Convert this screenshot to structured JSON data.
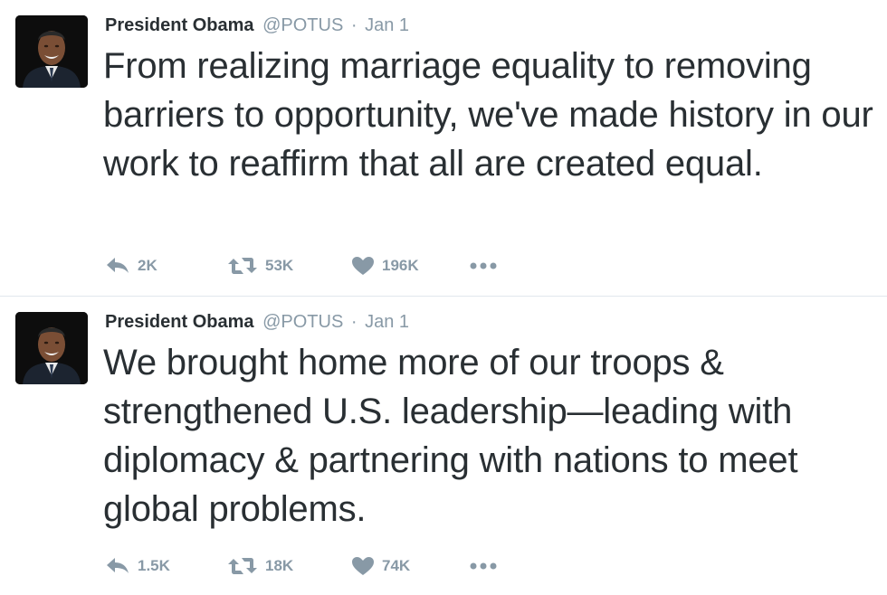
{
  "tweets": [
    {
      "name": "President Obama",
      "handle": "@POTUS",
      "separator": "·",
      "date": "Jan 1",
      "text": "From realizing marriage equality to removing barriers to opportunity, we've made history in our work to reaffirm that all are created equal.",
      "replies": "2K",
      "retweets": "53K",
      "likes": "196K"
    },
    {
      "name": "President Obama",
      "handle": "@POTUS",
      "separator": "·",
      "date": "Jan 1",
      "text": "We brought home more of our troops & strengthened U.S. leadership—leading with diplomacy & partnering with nations to meet global problems.",
      "replies": "1.5K",
      "retweets": "18K",
      "likes": "74K"
    }
  ],
  "icons": {
    "reply": "reply-icon",
    "retweet": "retweet-icon",
    "like": "heart-icon",
    "more": "more-dots-icon"
  },
  "colors": {
    "text": "#292f33",
    "meta": "#8899a6",
    "divider": "#e1e8ed"
  }
}
